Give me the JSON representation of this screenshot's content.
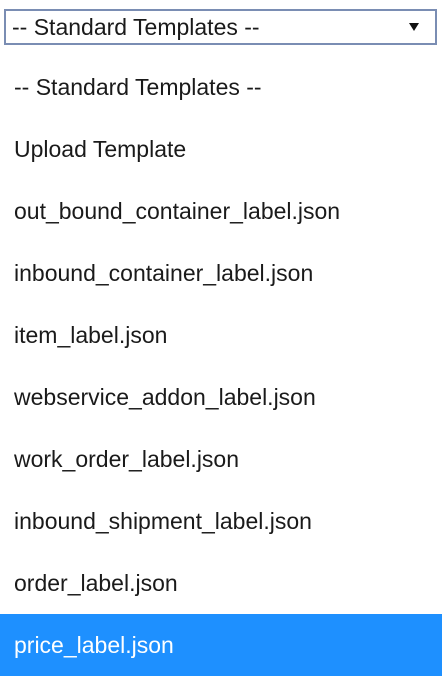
{
  "select": {
    "value": "-- Standard Templates --",
    "arrow_icon": "triangle-down-icon"
  },
  "options": [
    {
      "label": "-- Standard Templates --",
      "selected": false
    },
    {
      "label": "Upload Template",
      "selected": false
    },
    {
      "label": "out_bound_container_label.json",
      "selected": false
    },
    {
      "label": "inbound_container_label.json",
      "selected": false
    },
    {
      "label": "item_label.json",
      "selected": false
    },
    {
      "label": "webservice_addon_label.json",
      "selected": false
    },
    {
      "label": "work_order_label.json",
      "selected": false
    },
    {
      "label": "inbound_shipment_label.json",
      "selected": false
    },
    {
      "label": "order_label.json",
      "selected": false
    },
    {
      "label": "price_label.json",
      "selected": true
    }
  ],
  "colors": {
    "highlight": "#1e90ff",
    "highlight_text": "#ffffff",
    "border": "#7a8db3"
  }
}
